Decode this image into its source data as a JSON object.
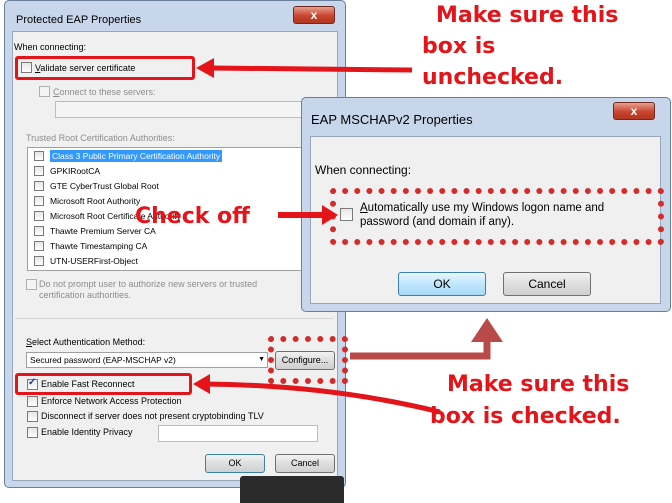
{
  "dialog_eap": {
    "title": "Protected EAP Properties",
    "when_connecting": "When connecting:",
    "validate_cert": "Validate server certificate",
    "connect_servers": "Connect to these servers:",
    "trusted_root": "Trusted Root Certification Authorities:",
    "authorities": [
      "Class 3 Public Primary Certification Authority",
      "GPKIRootCA",
      "GTE CyberTrust Global Root",
      "Microsoft Root Authority",
      "Microsoft Root Certificate Authority",
      "Thawte Premium Server CA",
      "Thawte Timestamping CA",
      "UTN-USERFirst-Object"
    ],
    "do_not_prompt_1": "Do not prompt user to authorize new servers or trusted",
    "do_not_prompt_2": "certification authorities.",
    "select_method": "Select Authentication Method:",
    "method_value": "Secured password (EAP-MSCHAP v2)",
    "configure": "Configure...",
    "enable_fast": "Enable Fast Reconnect",
    "enforce_nap": "Enforce Network Access Protection",
    "disconnect": "Disconnect if server does not present cryptobinding TLV",
    "identity_privacy": "Enable Identity Privacy",
    "ok": "OK",
    "cancel": "Cancel"
  },
  "dialog_mschap": {
    "title": "EAP MSCHAPv2 Properties",
    "when_connecting": "When connecting:",
    "auto_use_1": "Automatically use my Windows logon name and",
    "auto_use_2": "password (and domain if any).",
    "ok": "OK",
    "cancel": "Cancel"
  },
  "close_glyph": "x",
  "annotations": {
    "unchecked_1": "Make sure this",
    "unchecked_2": "box is",
    "unchecked_3": "unchecked.",
    "check_off": "Check off",
    "checked_1": "Make sure this",
    "checked_2": "box is checked."
  },
  "colors": {
    "annotation_red": "#e3151a",
    "selection_blue": "#3399ff",
    "dialog_frame": "#c7d6ea"
  }
}
